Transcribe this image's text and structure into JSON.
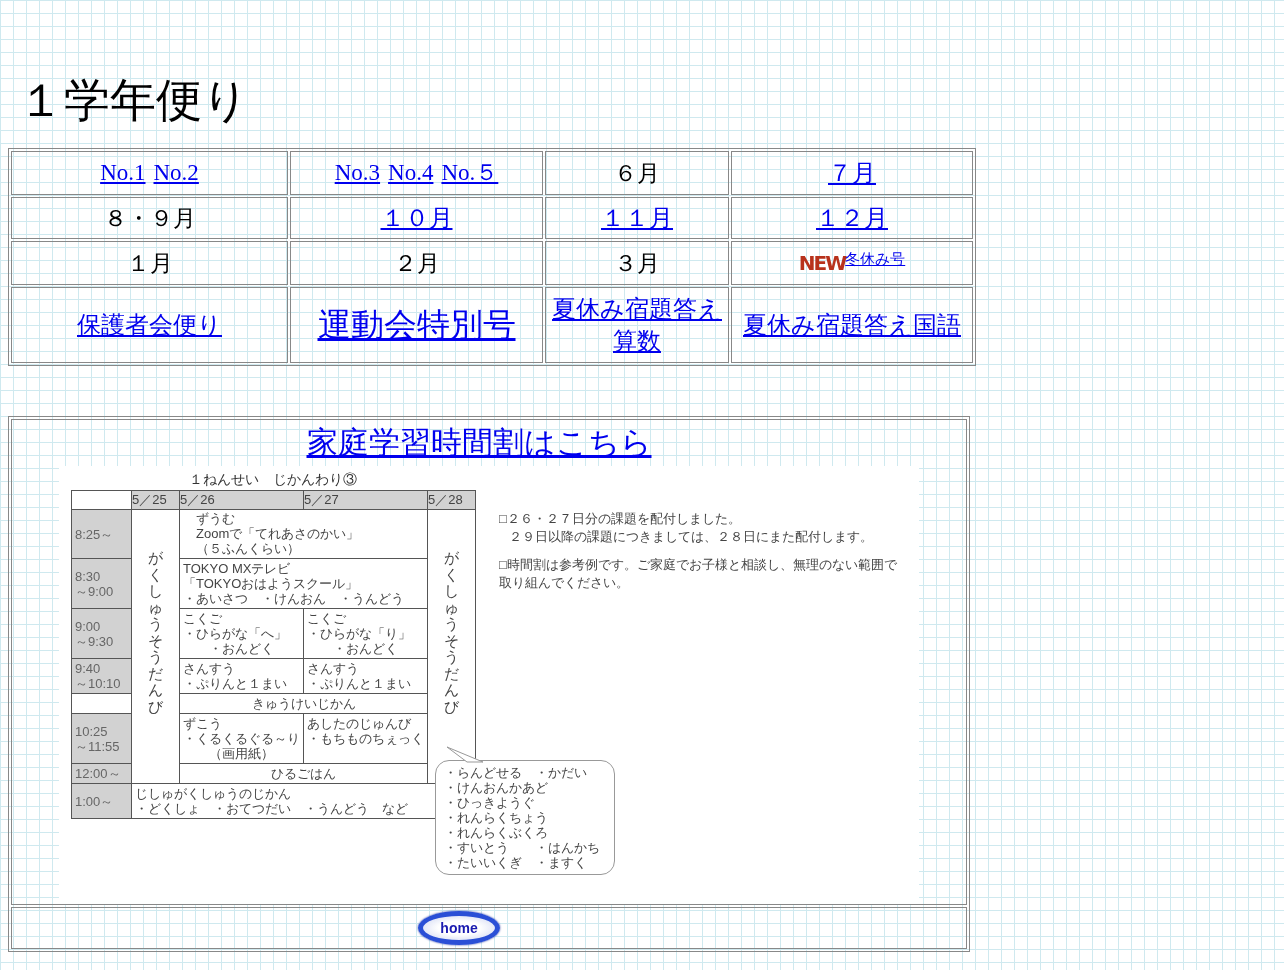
{
  "page_title": "１学年便り",
  "newsletter_table": {
    "rows": [
      [
        {
          "items": [
            {
              "kind": "serif_link",
              "text": "No.1"
            },
            {
              "kind": "serif_link",
              "text": "No.2"
            }
          ]
        },
        {
          "items": [
            {
              "kind": "serif_link",
              "text": "No.3"
            },
            {
              "kind": "serif_link",
              "text": "No.4"
            },
            {
              "kind": "serif_link",
              "text": "No.５"
            }
          ]
        },
        {
          "items": [
            {
              "kind": "text",
              "text": "６月"
            }
          ]
        },
        {
          "items": [
            {
              "kind": "link",
              "text": "７月"
            }
          ]
        }
      ],
      [
        {
          "items": [
            {
              "kind": "text",
              "text": "８・９月"
            }
          ]
        },
        {
          "items": [
            {
              "kind": "link",
              "text": "１０月"
            }
          ]
        },
        {
          "items": [
            {
              "kind": "link",
              "text": "１１月"
            }
          ]
        },
        {
          "items": [
            {
              "kind": "link",
              "text": "１２月"
            }
          ]
        }
      ],
      [
        {
          "items": [
            {
              "kind": "text",
              "text": "１月"
            }
          ]
        },
        {
          "items": [
            {
              "kind": "text",
              "text": "２月"
            }
          ]
        },
        {
          "items": [
            {
              "kind": "text",
              "text": "３月"
            }
          ]
        },
        {
          "items": [
            {
              "kind": "new_badge",
              "text": "NEW"
            },
            {
              "kind": "small_link",
              "text": "冬休み号"
            }
          ]
        }
      ],
      [
        {
          "items": [
            {
              "kind": "link",
              "text": "保護者会便り"
            }
          ]
        },
        {
          "items": [
            {
              "kind": "large_link",
              "text": "運動会特別号"
            }
          ]
        },
        {
          "items": [
            {
              "kind": "link",
              "text": "夏休み宿題答え算数"
            }
          ]
        },
        {
          "items": [
            {
              "kind": "link",
              "text": "夏休み宿題答え国語"
            }
          ]
        }
      ]
    ]
  },
  "schedule": {
    "link": "家庭学習時間割はこちら",
    "timetable": {
      "title": "１ねんせい　じかんわり③",
      "dates": [
        "5／25",
        "5／26",
        "5／27",
        "5／28"
      ],
      "side_label_left": "がくしゅうそうだんび",
      "side_label_right": "がくしゅうそうだんび",
      "rows": [
        {
          "kind": "span",
          "time": [
            "8:25～"
          ],
          "ruby": {
            "base": "Zoom",
            "text": "ずうむ"
          },
          "lines": [
            "で「てれあさのかい」",
            "（５ふんくらい）"
          ]
        },
        {
          "kind": "span",
          "time": [
            "8:30",
            "～9:00"
          ],
          "lines": [
            "TOKYO MXテレビ",
            "「TOKYOおはようスクール」",
            "・あいさつ　・けんおん　・うんどう"
          ]
        },
        {
          "kind": "split",
          "time": [
            "9:00",
            "～9:30"
          ],
          "cells": [
            [
              "こくご",
              "・ひらがな「へ」",
              "・おんどく"
            ],
            [
              "こくご",
              "・ひらがな「り」",
              "・おんどく"
            ]
          ]
        },
        {
          "kind": "split",
          "time": [
            "9:40",
            "～10:10"
          ],
          "cells": [
            [
              "さんすう",
              "・ぷりんと１まい"
            ],
            [
              "さんすう",
              "・ぷりんと１まい"
            ]
          ]
        },
        {
          "kind": "span",
          "time": [],
          "lines": [
            "きゅうけいじかん"
          ]
        },
        {
          "kind": "split",
          "time": [
            "10:25",
            "～11:55"
          ],
          "cells": [
            [
              "ずこう",
              "・くるくるぐる～り",
              "（画用紙）"
            ],
            [
              "あしたのじゅんび",
              "・もちものちぇっく"
            ]
          ]
        },
        {
          "kind": "span",
          "time": [
            "12:00～"
          ],
          "lines": [
            "ひるごはん"
          ]
        },
        {
          "kind": "full",
          "time": [
            "1:00～"
          ],
          "lines": [
            "じしゅがくしゅうのじかん",
            "・どくしょ　・おてつだい　・うんどう　など"
          ]
        }
      ],
      "bubble": [
        "・らんどせる　・かだい",
        "・けんおんかあど",
        "・ひっきようぐ",
        "・れんらくちょう",
        "・れんらくぶくろ",
        "・すいとう　　・はんかち",
        "・たいいくぎ　・ますく"
      ],
      "notes": [
        [
          "□２６・２７日分の課題を配付しました。",
          "２９日以降の課題につきましては、２８日にまた配付します。"
        ],
        [
          "□時間割は参考例です。ご家庭でお子様と相談し、無理のない範囲で取り組んでください。"
        ]
      ]
    }
  },
  "home_button": "home"
}
